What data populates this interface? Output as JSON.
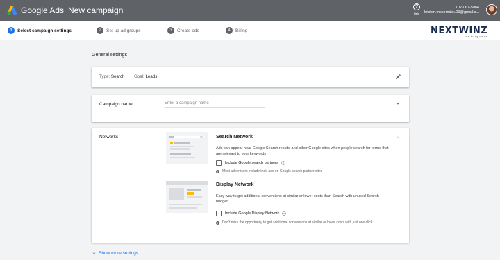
{
  "header": {
    "brand": "Google Ads",
    "page_title": "New campaign",
    "help_label": "Help",
    "account_phone": "102-067-5084",
    "account_email": "kristen.mccormick.09@gmail.c..."
  },
  "steps": [
    {
      "num": "1",
      "label": "Select campaign settings",
      "active": true
    },
    {
      "num": "2",
      "label": "Set up ad groups",
      "active": false
    },
    {
      "num": "3",
      "label": "Create ads",
      "active": false
    },
    {
      "num": "4",
      "label": "Billing",
      "active": false
    }
  ],
  "watermark": {
    "name": "NEXTWINZ",
    "tagline": "we bring value"
  },
  "general": {
    "section_title": "General settings",
    "type_label": "Type:",
    "type_value": "Search",
    "goal_label": "Goal:",
    "goal_value": "Leads"
  },
  "campaign_name": {
    "label": "Campaign name",
    "placeholder": "Enter a campaign name",
    "value": ""
  },
  "networks": {
    "label": "Networks",
    "search": {
      "title": "Search Network",
      "description": "Ads can appear near Google Search results and other Google sites when people search for terms that are relevant to your keywords",
      "checkbox_label": "Include Google search partners",
      "checked": false,
      "info": "Most advertisers include their ads on Google search partner sites"
    },
    "display": {
      "title": "Display Network",
      "description": "Easy way to get additional conversions at similar or lower costs than Search with unused Search budget.",
      "checkbox_label": "Include Google Display Network",
      "checked": false,
      "info": "Don't miss the opportunity to get additional conversions at similar or lower costs with just one click."
    }
  },
  "show_more_label": "Show more settings",
  "colors": {
    "accent": "#1a73e8",
    "header": "#5f6368",
    "background": "#f1f3f4"
  }
}
